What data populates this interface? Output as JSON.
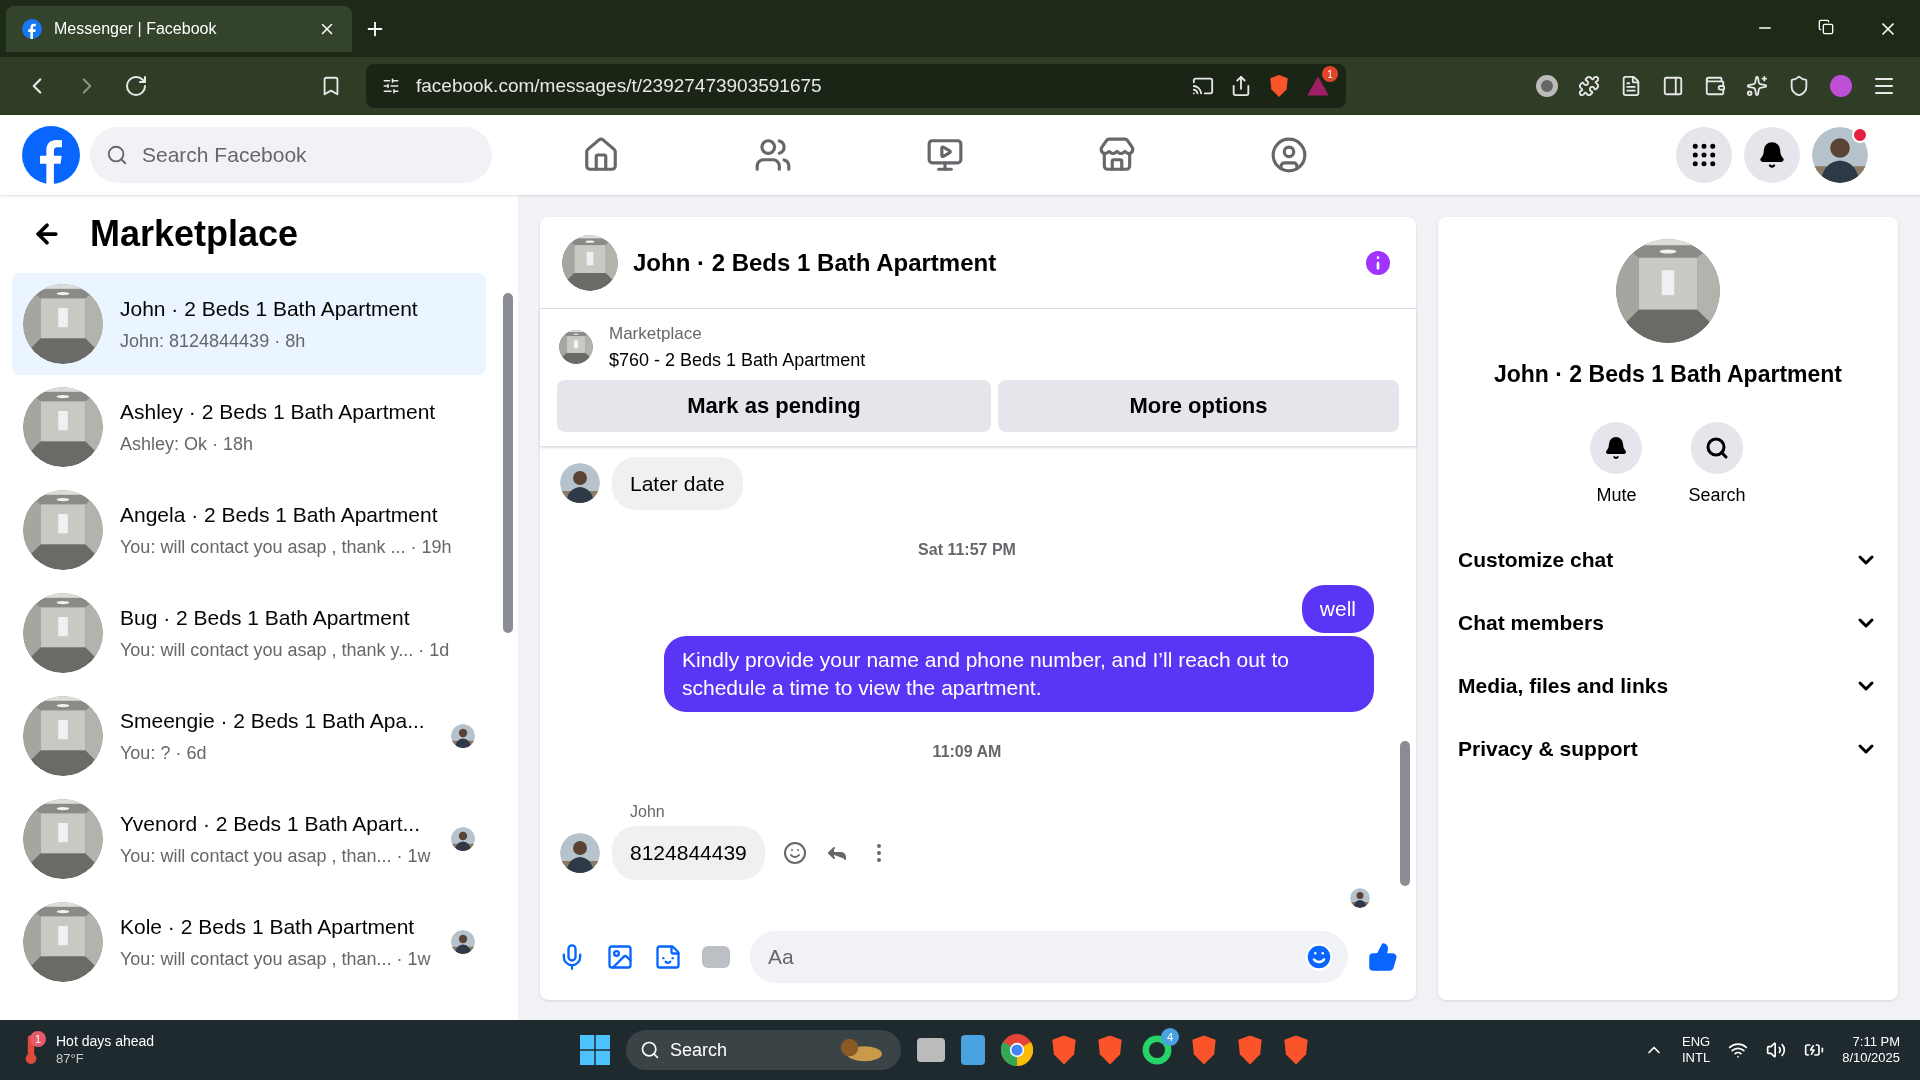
{
  "browser": {
    "tab_title": "Messenger | Facebook",
    "url": "facebook.com/messages/t/23927473903591675",
    "alert_count": "1"
  },
  "header": {
    "search_placeholder": "Search Facebook"
  },
  "sidebar": {
    "title": "Marketplace",
    "conversations": [
      {
        "title": "John · 2 Beds 1 Bath Apartment",
        "preview": "John: 8124844439 · 8h",
        "selected": true,
        "read_receipt": false
      },
      {
        "title": "Ashley · 2 Beds 1 Bath Apartment",
        "preview": "Ashley: Ok · 18h",
        "selected": false,
        "read_receipt": false
      },
      {
        "title": "Angela · 2 Beds 1 Bath Apartment",
        "preview": "You: will contact you asap , thank ... · 19h",
        "selected": false,
        "read_receipt": false
      },
      {
        "title": "Bug · 2 Beds 1 Bath Apartment",
        "preview": "You: will contact you asap , thank y... · 1d",
        "selected": false,
        "read_receipt": false
      },
      {
        "title": "Smeengie · 2 Beds 1 Bath Apa...",
        "preview": "You: ? · 6d",
        "selected": false,
        "read_receipt": true
      },
      {
        "title": "Yvenord · 2 Beds 1 Bath Apart...",
        "preview": "You: will contact you asap , than... · 1w",
        "selected": false,
        "read_receipt": true
      },
      {
        "title": "Kole · 2 Beds 1 Bath Apartment",
        "preview": "You: will contact you asap , than... · 1w",
        "selected": false,
        "read_receipt": true
      }
    ]
  },
  "chat": {
    "title": "John · 2 Beds 1 Bath Apartment",
    "listing": {
      "label": "Marketplace",
      "text": "$760 - 2 Beds 1 Bath Apartment"
    },
    "actions": [
      "Mark as pending",
      "More options"
    ],
    "messages": [
      {
        "kind": "incoming",
        "text": "Later date",
        "hovered": false
      },
      {
        "kind": "timestamp",
        "text": "Sat 11:57 PM"
      },
      {
        "kind": "outgoing",
        "text": "well"
      },
      {
        "kind": "outgoing",
        "text": "Kindly provide your name and phone number, and I’ll reach out to schedule a time to view the apartment."
      },
      {
        "kind": "timestamp",
        "text": "11:09 AM"
      },
      {
        "kind": "sender",
        "text": "John"
      },
      {
        "kind": "incoming",
        "text": "8124844439",
        "hovered": true
      }
    ],
    "composer_placeholder": "Aa"
  },
  "details": {
    "title": "John · 2 Beds 1 Bath Apartment",
    "actions": [
      {
        "kind": "mute",
        "label": "Mute"
      },
      {
        "kind": "search",
        "label": "Search"
      }
    ],
    "sections": [
      "Customize chat",
      "Chat members",
      "Media, files and links",
      "Privacy & support"
    ]
  },
  "taskbar": {
    "weather": "Hot days ahead",
    "temperature": "87°F",
    "weather_badge": "1",
    "search": "Search",
    "chat_badge": "4",
    "language": "ENG",
    "layout": "INTL",
    "time": "7:11 PM",
    "date": "8/10/2025"
  }
}
